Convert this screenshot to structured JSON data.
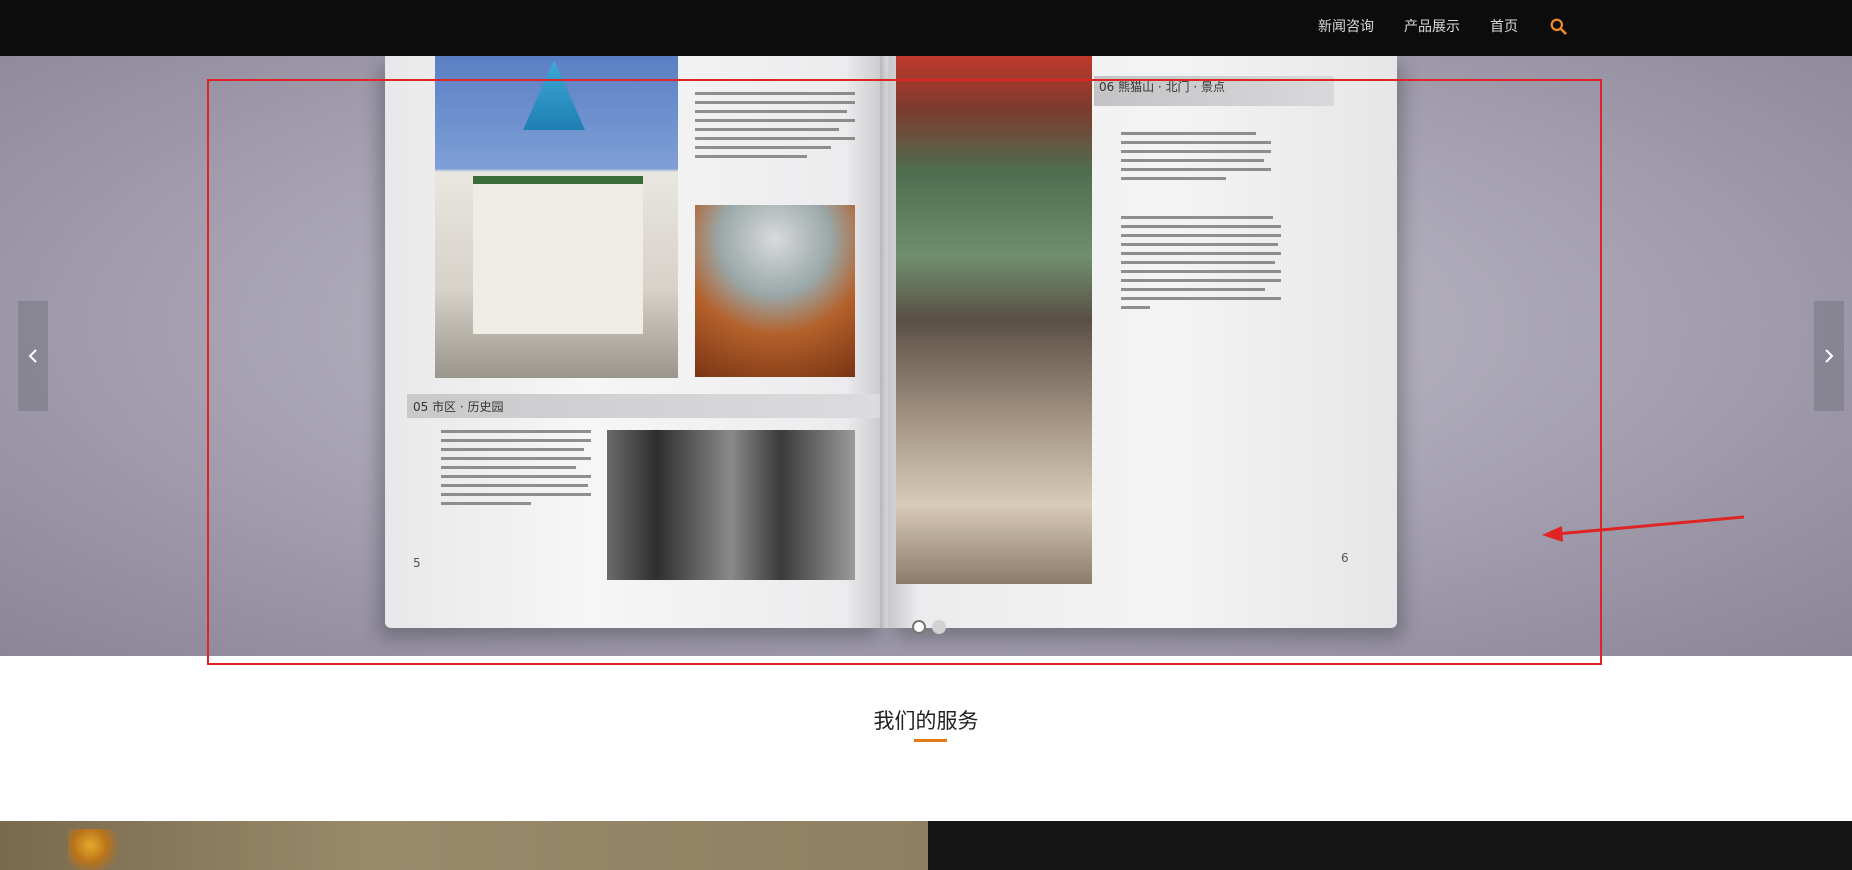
{
  "nav": {
    "items": [
      "新闻咨询",
      "产品展示",
      "首页"
    ],
    "search_icon": "search-icon",
    "accent_color": "#f28c28"
  },
  "hero": {
    "left_page": {
      "section_title": "05 市区 · 历史园",
      "page_number": "5"
    },
    "right_page": {
      "section_title": "06 熊猫山 · 北门 · 景点",
      "page_number": "6"
    },
    "prev_icon": "chevron-left-icon",
    "next_icon": "chevron-right-icon",
    "slide_count": 2,
    "active_slide": 1
  },
  "services": {
    "title": "我们的服务",
    "accent_color": "#e07b16"
  }
}
